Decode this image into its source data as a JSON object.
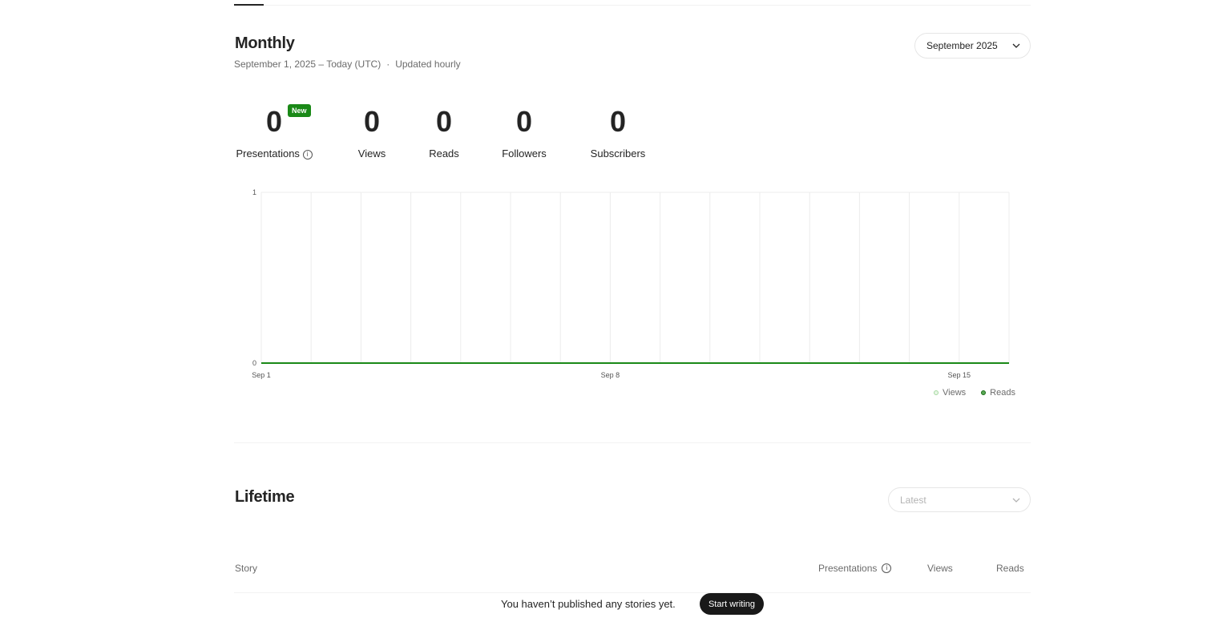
{
  "monthly": {
    "title": "Monthly",
    "date_range": "September 1, 2025 – Today (UTC)",
    "separator": "·",
    "updated": "Updated hourly",
    "month_select": {
      "value": "September 2025",
      "icon": "chevron-down-icon"
    }
  },
  "stats": [
    {
      "value": "0",
      "label": "Presentations",
      "badge": "New",
      "info_icon": "info-icon"
    },
    {
      "value": "0",
      "label": "Views"
    },
    {
      "value": "0",
      "label": "Reads"
    },
    {
      "value": "0",
      "label": "Followers"
    },
    {
      "value": "0",
      "label": "Subscribers"
    }
  ],
  "chart_data": {
    "type": "line",
    "x_tick_labels": [
      "Sep 1",
      "Sep 8",
      "Sep 15"
    ],
    "y_tick_labels": [
      "1",
      "0"
    ],
    "ylim": [
      0,
      1
    ],
    "x": [
      1,
      2,
      3,
      4,
      5,
      6,
      7,
      8,
      9,
      10,
      11,
      12,
      13,
      14,
      15,
      16
    ],
    "series": [
      {
        "name": "Views",
        "values": [
          0,
          0,
          0,
          0,
          0,
          0,
          0,
          0,
          0,
          0,
          0,
          0,
          0,
          0,
          0,
          0
        ],
        "color": "#c9ecc5"
      },
      {
        "name": "Reads",
        "values": [
          0,
          0,
          0,
          0,
          0,
          0,
          0,
          0,
          0,
          0,
          0,
          0,
          0,
          0,
          0,
          0
        ],
        "color": "#1a8917"
      }
    ],
    "grid": true,
    "legend_position": "bottom-right"
  },
  "lifetime": {
    "title": "Lifetime",
    "sort_select": {
      "placeholder": "Latest",
      "icon": "chevron-down-icon"
    },
    "columns": [
      "Story",
      "Presentations",
      "Views",
      "Reads"
    ],
    "empty_message": "You haven’t published any stories yet.",
    "cta_label": "Start writing"
  },
  "colors": {
    "accent": "#1a8917",
    "text": "#242424",
    "muted": "#6b6b6b"
  }
}
